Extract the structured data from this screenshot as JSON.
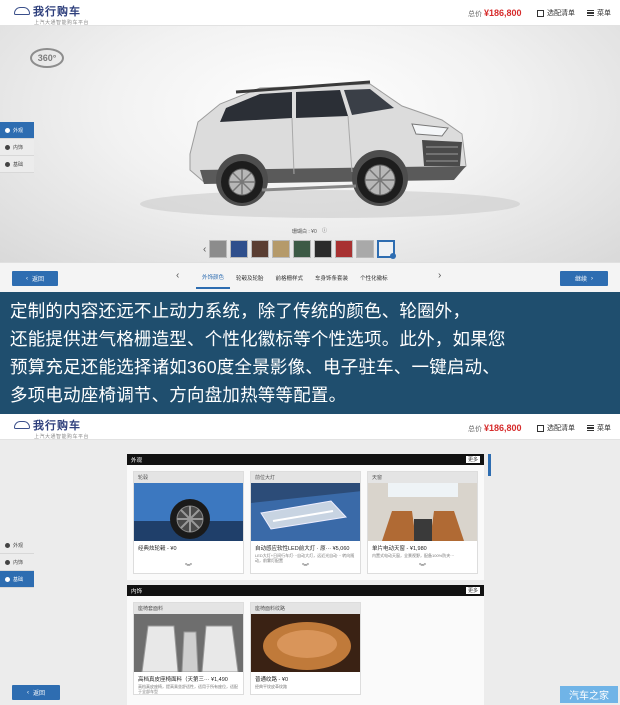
{
  "brand": {
    "name": "我行购车",
    "tagline": "上汽大通智能购车平台"
  },
  "header": {
    "price_label": "总价",
    "price_value": "¥186,800",
    "list_label": "选配清单",
    "menu_label": "菜单"
  },
  "viewer": {
    "badge_360": "360°",
    "side_menu": [
      {
        "label": "外观",
        "active": true
      },
      {
        "label": "内饰",
        "active": false
      },
      {
        "label": "基础",
        "active": false
      }
    ],
    "color_price": "珊瑚白 : ¥0",
    "swatch_colors": [
      "#8c8c8c",
      "#2f4f8c",
      "#5a3e32",
      "#b59a6a",
      "#3c5a45",
      "#2b2b2b",
      "#a83232",
      "#a9a9a9",
      "#eef1f4"
    ],
    "selected_swatch": 8
  },
  "bottom_bar": {
    "back_label": "返回",
    "next_label": "继续",
    "tabs": [
      {
        "label": "外饰颜色",
        "active": true
      },
      {
        "label": "轮毂及轮胎",
        "active": false
      },
      {
        "label": "前格栅样式",
        "active": false
      },
      {
        "label": "车身饰条套装",
        "active": false
      },
      {
        "label": "个性化徽标",
        "active": false
      }
    ]
  },
  "caption": {
    "lines": [
      "定制的内容还远不止动力系统，除了传统的颜色、轮圈外，",
      "还能提供进气格栅造型、个性化徽标等个性选项。此外，如果您",
      "预算充足还能选择诸如360度全景影像、电子驻车、一键启动、",
      "多项电动座椅调节、方向盘加热等等配置。"
    ]
  },
  "lower": {
    "side_menu": [
      {
        "label": "外观",
        "active": false
      },
      {
        "label": "内饰",
        "active": false
      },
      {
        "label": "基础",
        "active": true
      }
    ],
    "sections": [
      {
        "title": "外观",
        "more": "更多",
        "cards": [
          {
            "title": "轮毂",
            "name": "经典炫轮毂 - ¥0",
            "desc": "",
            "img": "wheel"
          },
          {
            "title": "前位大灯",
            "name": "自动感应软性LED前大灯 · 原··· ¥5,060",
            "desc": "LED大灯+日间行车灯···自动大灯，远近光自动··· 转向随动，前雾灯配置",
            "img": "headlight"
          },
          {
            "title": "天窗",
            "name": "单片电动天窗 - ¥1,980",
            "desc": "内置式电动天窗，全景视野，配备100%防夹···",
            "img": "sunroof"
          }
        ]
      },
      {
        "title": "内饰",
        "more": "更多",
        "cards": [
          {
            "title": "座椅套面料",
            "name": "高档真皮座椅面料（天第三··· ¥1,490",
            "desc": "高档真皮座椅，提高乘坐舒适性，适用于所有座位，适配于全部车型",
            "img": "seats"
          },
          {
            "title": "座椅面料纹路",
            "name": "普通纹路 - ¥0",
            "desc": "经典平纹皮革纹路",
            "img": "seat-pattern"
          }
        ]
      }
    ],
    "watermark": "汽车之家"
  }
}
